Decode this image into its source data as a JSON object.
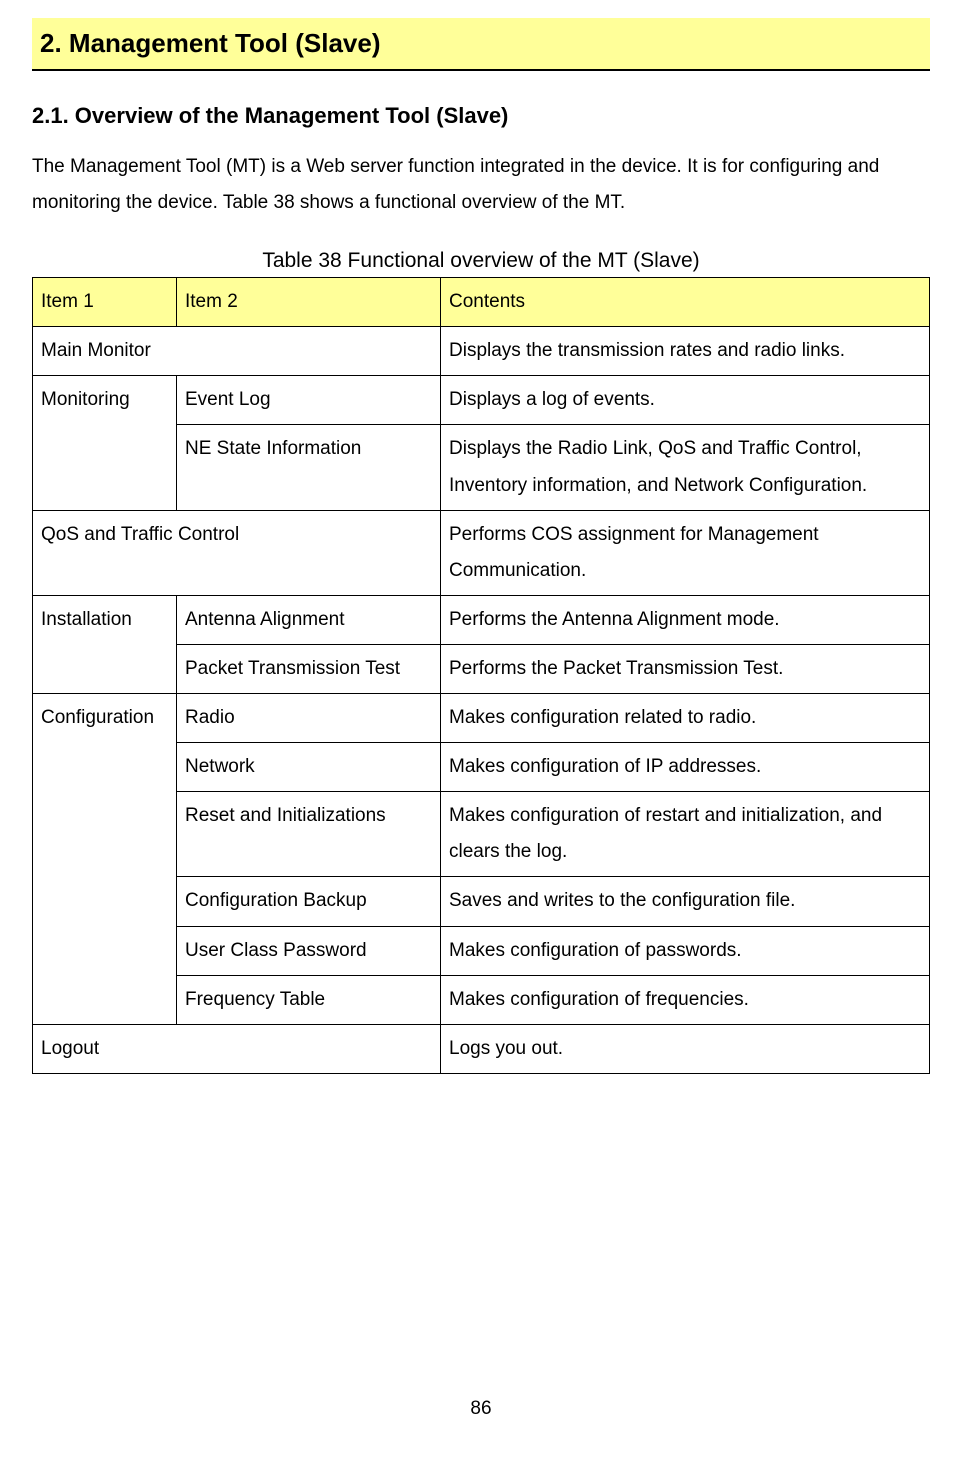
{
  "chapter_title": "2.  Management Tool (Slave)",
  "section_title": "2.1.  Overview of the Management Tool (Slave)",
  "intro_paragraph": "The Management Tool (MT) is a Web server function integrated in the device. It is for configuring and monitoring the device. Table 38 shows a functional overview of the MT.",
  "table_caption": "Table 38 Functional overview of the MT (Slave)",
  "headers": {
    "h1": "Item 1",
    "h2": "Item 2",
    "h3": "Contents"
  },
  "rows": {
    "main_monitor_item": "Main Monitor",
    "main_monitor_contents": "Displays the transmission rates and radio links.",
    "monitoring_item": "Monitoring",
    "monitoring_event_log": "Event Log",
    "monitoring_event_log_contents": "Displays a log of events.",
    "monitoring_ne_state": "NE State Information",
    "monitoring_ne_state_contents": "Displays the Radio Link, QoS and Traffic Control, Inventory information, and Network Configuration.",
    "qos_item": "QoS and Traffic Control",
    "qos_contents": "Performs COS assignment for Management Communication.",
    "installation_item": "Installation",
    "installation_antenna": "Antenna Alignment",
    "installation_antenna_contents": "Performs the Antenna Alignment mode.",
    "installation_packet": "Packet Transmission Test",
    "installation_packet_contents": "Performs the Packet Transmission Test.",
    "configuration_item": "Configuration",
    "configuration_radio": "Radio",
    "configuration_radio_contents": "Makes configuration related to radio.",
    "configuration_network": "Network",
    "configuration_network_contents": "Makes configuration of IP addresses.",
    "configuration_reset": "Reset and Initializations",
    "configuration_reset_contents": "Makes configuration of restart and initialization, and clears the log.",
    "configuration_backup": "Configuration Backup",
    "configuration_backup_contents": "Saves and writes to the configuration file.",
    "configuration_password": "User Class Password",
    "configuration_password_contents": "Makes configuration of passwords.",
    "configuration_frequency": "Frequency Table",
    "configuration_frequency_contents": "Makes configuration of frequencies.",
    "logout_item": "Logout",
    "logout_contents": "Logs you out."
  },
  "page_number": "86"
}
